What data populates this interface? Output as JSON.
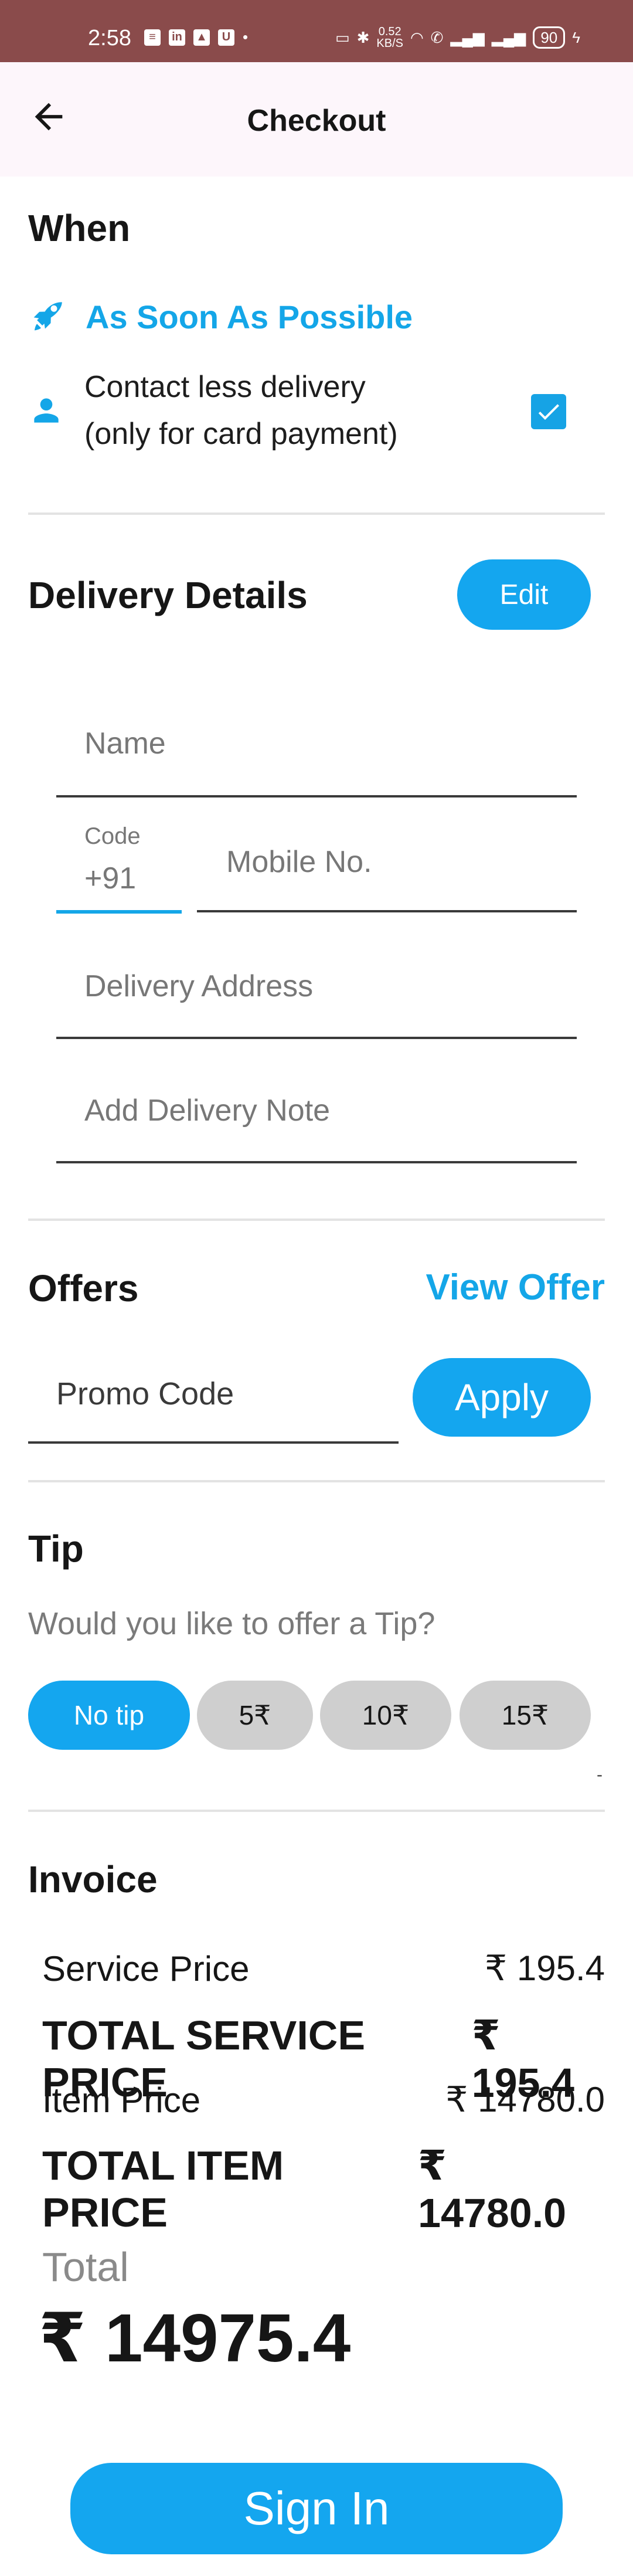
{
  "status_bar": {
    "time": "2:58",
    "speed_value": "0.52",
    "speed_unit": "KB/S",
    "battery": "90"
  },
  "header": {
    "title": "Checkout"
  },
  "when": {
    "title": "When",
    "asap_label": "As Soon As Possible",
    "contactless_line1": "Contact less delivery",
    "contactless_line2": "(only for card payment)",
    "contactless_checked": true
  },
  "delivery": {
    "title": "Delivery Details",
    "edit_label": "Edit",
    "name_placeholder": "Name",
    "code_label": "Code",
    "code_value": "+91",
    "mobile_placeholder": "Mobile No.",
    "address_placeholder": "Delivery Address",
    "note_placeholder": "Add Delivery Note"
  },
  "offers": {
    "title": "Offers",
    "view_offer_label": "View Offer",
    "promo_placeholder": "Promo Code",
    "apply_label": "Apply"
  },
  "tip": {
    "title": "Tip",
    "prompt": "Would you like to offer a Tip?",
    "options": [
      "No tip",
      "5₹",
      "10₹",
      "15₹"
    ],
    "selected": "No tip",
    "trailing_mark": "-"
  },
  "invoice": {
    "title": "Invoice",
    "rows": [
      {
        "label": "Service Price",
        "value": "₹ 195.4"
      },
      {
        "label": "TOTAL SERVICE PRICE",
        "value": "₹ 195.4"
      },
      {
        "label": "Item Price",
        "value": "₹ 14780.0"
      },
      {
        "label": "TOTAL ITEM PRICE",
        "value": "₹ 14780.0"
      }
    ],
    "total_label": "Total",
    "total_value": "₹ 14975.4"
  },
  "footer": {
    "sign_in_label": "Sign In"
  },
  "colors": {
    "accent": "#14a6ef",
    "status_bar": "#8a4b4b",
    "app_bar": "#fdf6fb",
    "chip_grey": "#cfcfcf"
  }
}
